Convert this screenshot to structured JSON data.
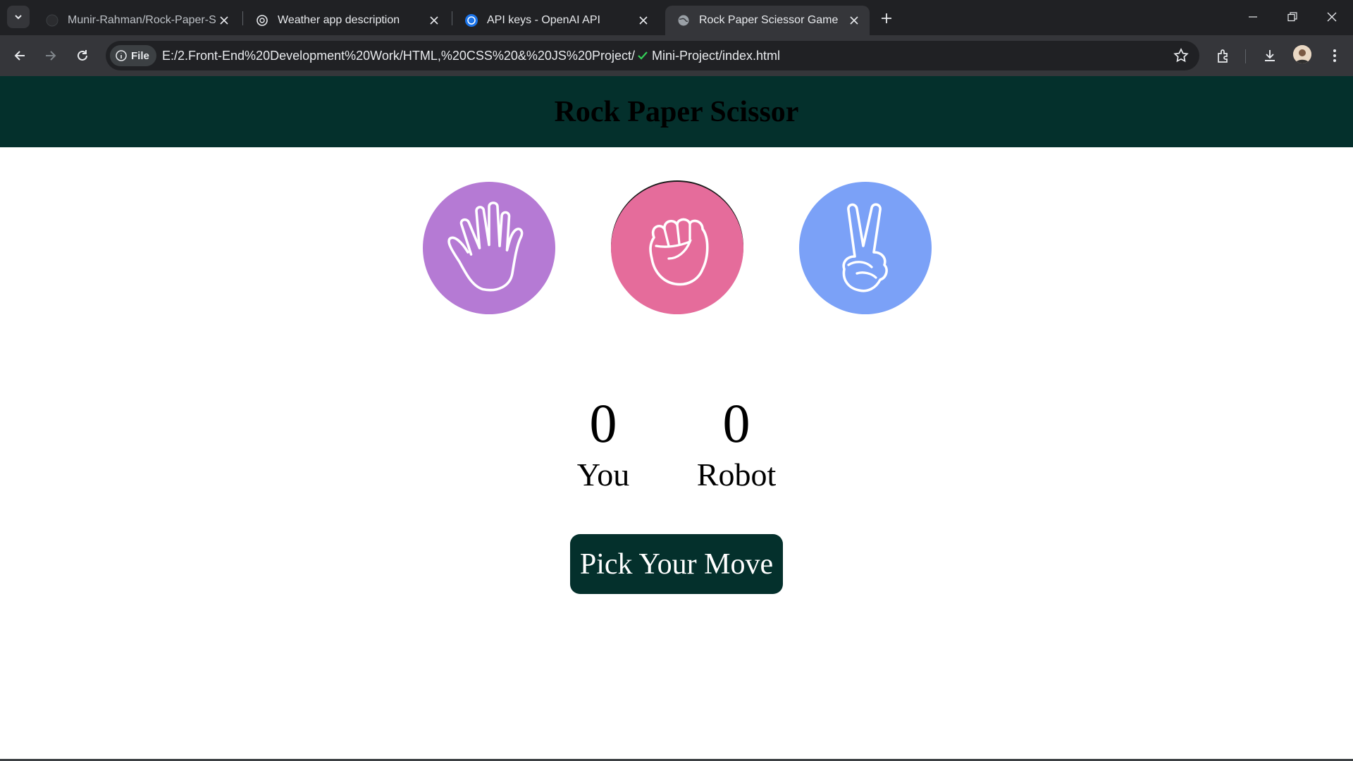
{
  "browser": {
    "tabs": [
      {
        "title": "Munir-Rahman/Rock-Paper-Sci",
        "icon": "github-icon",
        "active": false
      },
      {
        "title": "Weather app description",
        "icon": "openai-icon",
        "active": false
      },
      {
        "title": "API keys - OpenAI API",
        "icon": "openai-api-icon",
        "active": false
      },
      {
        "title": "Rock Paper Sciessor Game",
        "icon": "globe-icon",
        "active": true
      }
    ],
    "site_chip": "File",
    "url_prefix": "E:/2.Front-End%20Development%20Work/HTML,%20CSS%20&%20JS%20Project/",
    "url_suffix": "Mini-Project/index.html",
    "colors": {
      "tabbar": "#202124",
      "toolbar": "#35363a",
      "omnibox": "#202124"
    }
  },
  "game": {
    "title": "Rock Paper Scissor",
    "choices": [
      {
        "name": "paper",
        "icon": "open-hand-icon",
        "color": "#b57ad4"
      },
      {
        "name": "rock",
        "icon": "fist-icon",
        "color": "#e56c9b"
      },
      {
        "name": "scissor",
        "icon": "peace-hand-icon",
        "color": "#7ba1f7"
      }
    ],
    "scores": {
      "you_value": "0",
      "you_label": "You",
      "robot_value": "0",
      "robot_label": "Robot"
    },
    "message": "Pick Your Move",
    "colors": {
      "header": "#04302c",
      "button": "#04302c"
    }
  }
}
